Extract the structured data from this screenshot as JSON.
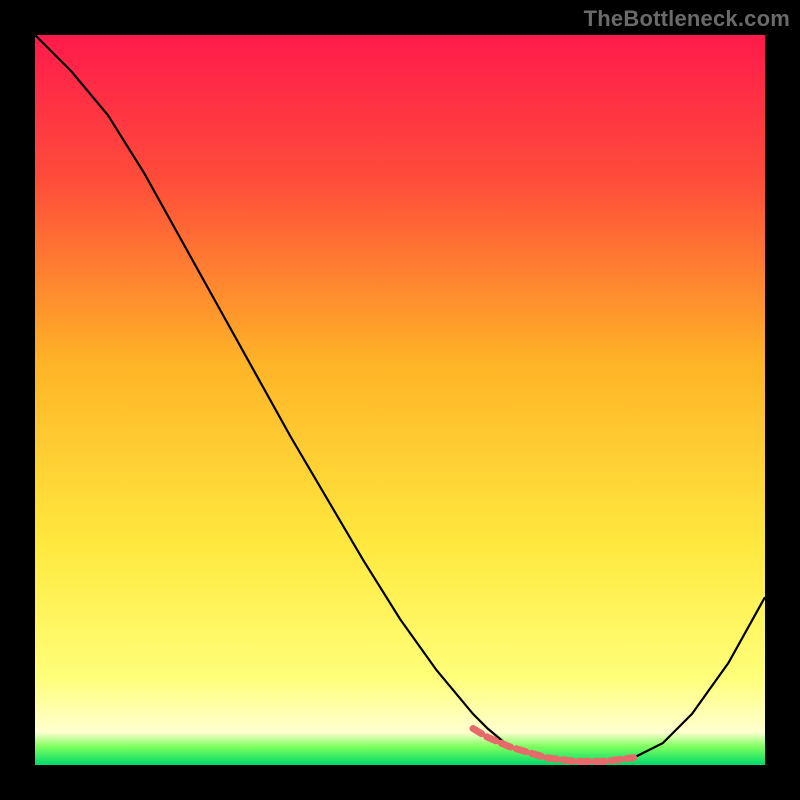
{
  "watermark": "TheBottleneck.com",
  "chart_data": {
    "type": "line",
    "title": "",
    "xlabel": "",
    "ylabel": "",
    "xlim": [
      0,
      100
    ],
    "ylim": [
      0,
      100
    ],
    "grid": false,
    "gradient_stops": [
      {
        "offset": 0.0,
        "color": "#ff1a4b"
      },
      {
        "offset": 0.2,
        "color": "#ff4d3a"
      },
      {
        "offset": 0.45,
        "color": "#ffb427"
      },
      {
        "offset": 0.7,
        "color": "#ffe93f"
      },
      {
        "offset": 0.88,
        "color": "#ffff7a"
      },
      {
        "offset": 0.955,
        "color": "#ffffd0"
      },
      {
        "offset": 0.975,
        "color": "#7dff5e"
      },
      {
        "offset": 1.0,
        "color": "#00d96b"
      }
    ],
    "series": [
      {
        "name": "bottleneck-curve",
        "x": [
          0,
          5,
          10,
          15,
          20,
          25,
          30,
          35,
          40,
          45,
          50,
          55,
          60,
          62,
          65,
          70,
          74,
          78,
          82,
          86,
          90,
          95,
          100
        ],
        "y": [
          100,
          95,
          89,
          81,
          72,
          63,
          54,
          45,
          36.5,
          28,
          20,
          13,
          7,
          5,
          2.5,
          1.0,
          0.5,
          0.5,
          1.0,
          3.0,
          7.0,
          14.0,
          23.0
        ],
        "stroke": "#000000",
        "stroke_width": 2.2
      },
      {
        "name": "bottom-dash",
        "x": [
          60,
          62,
          65,
          70,
          74,
          78,
          82
        ],
        "y": [
          5.0,
          3.8,
          2.5,
          1.0,
          0.5,
          0.5,
          1.0
        ],
        "stroke": "#e76a6a",
        "stroke_width": 7,
        "dash": "10 6"
      }
    ]
  }
}
